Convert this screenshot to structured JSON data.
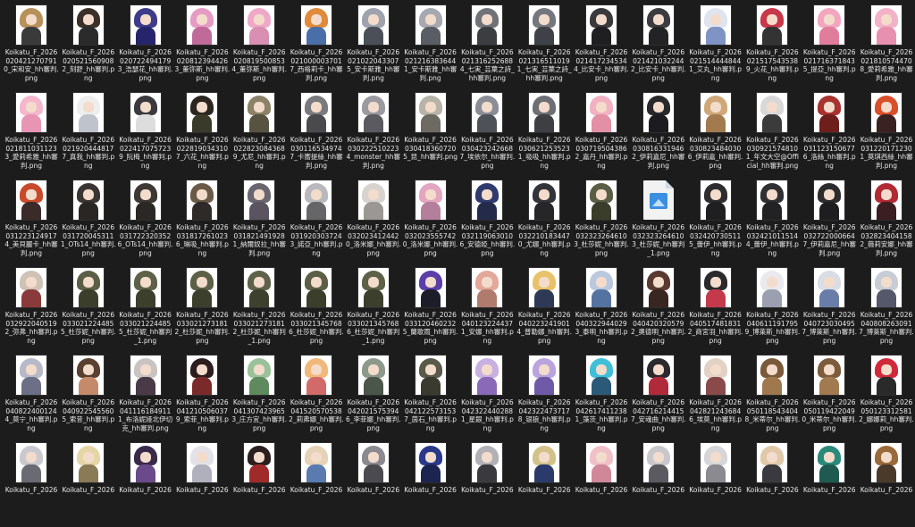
{
  "colors": {
    "background": "#1c1c1c",
    "text": "#e8e8e8",
    "image_icon": "#3b8fe0"
  },
  "files": [
    {
      "name": "Koikatu_F_2026020421270791 0_宋和安_hh審判.png",
      "hair": "#b8905a",
      "body": "#3a3a3a"
    },
    {
      "name": "Koikatu_F_2026020521560908 2_刻舒_hh審判.png",
      "hair": "#3b3028",
      "body": "#2b2b2b"
    },
    {
      "name": "Koikatu_F_2026020722494179 3_浩瑟花_hh審判.png",
      "hair": "#3e3b8a",
      "body": "#26246a"
    },
    {
      "name": "Koikatu_F_2026020812394426 3_董弥斯_hh審判.png",
      "hair": "#e59cc4",
      "body": "#c06a9a"
    },
    {
      "name": "Koikatu_F_2026020819500853 4_董弥斯_hh審判.png",
      "hair": "#f0a8c8",
      "body": "#d88fb1"
    },
    {
      "name": "Koikatu_F_2026021000003701 7_西格莉卡_hh審判.png",
      "hair": "#e08a3c",
      "body": "#4a6ea8"
    },
    {
      "name": "Koikatu_F_2026021022043307 5_安卡斯雅_hh審判.png",
      "hair": "#9ea3ad",
      "body": "#4b4f57"
    },
    {
      "name": "Koikatu_F_2026021216383644 1_安卡斯雅_hh審判.png",
      "hair": "#a6a9b0",
      "body": "#5a5d63"
    },
    {
      "name": "Koikatu_F_2026021316252688 4_七実_芸葉之詩_hh審判.png",
      "hair": "#6f7378",
      "body": "#3b3d40"
    },
    {
      "name": "Koikatu_F_2026021316511019 1_七実_芸葉之詩_hh審判.png",
      "hair": "#74787e",
      "body": "#3f4146"
    },
    {
      "name": "Koikatu_F_2026021417234534 4_比安卡_hh審判.png",
      "hair": "#3a3a3d",
      "body": "#1f1f22"
    },
    {
      "name": "Koikatu_F_2026021421032244 2_比安卡_hh審判.png",
      "hair": "#3c3c40",
      "body": "#232326"
    },
    {
      "name": "Koikatu_F_2026021514444844 1_艾丸_hh審判.png",
      "hair": "#dfe4ee",
      "body": "#7f93c4"
    },
    {
      "name": "Koikatu_F_2026021517543538 9_火花_hh審判.png",
      "hair": "#c8384a",
      "body": "#333333"
    },
    {
      "name": "Koikatu_F_2026021716371843 5_提亞_hh審判.png",
      "hair": "#f2a6c0",
      "body": "#e07d9d"
    },
    {
      "name": "Koikatu_F_2026021810574470 8_愛莉希雅_hh審判.png",
      "hair": "#f3b2c8",
      "body": "#e790b0"
    },
    {
      "name": "Koikatu_F_2026021811031123 3_愛莉希雅_hh審判.png",
      "hair": "#f4b7cc",
      "body": "#e895b4"
    },
    {
      "name": "Koikatu_F_2026021920444817 7_真我_hh審判.png",
      "hair": "#eeeeee",
      "body": "#bfc4cc"
    },
    {
      "name": "Koikatu_F_2026022417075723 9_阮梅_hh審判.png",
      "hair": "#3a3a3e",
      "body": "#dddddd"
    },
    {
      "name": "Koikatu_F_2026022819034310 7_六花_hh審判.png",
      "hair": "#2b2620",
      "body": "#3a3a2a"
    },
    {
      "name": "Koikatu_F_2026022823084368 9_尤尼_hh審判.png",
      "hair": "#8c8268",
      "body": "#585241"
    },
    {
      "name": "Koikatu_F_2026030116534974 7_卡嚮提絲_hh審判.png",
      "hair": "#7a7a7e",
      "body": "#4a4a4e"
    },
    {
      "name": "Koikatu_F_2026030222510223 4_monster_hh審判.png",
      "hair": "#9a9aa0",
      "body": "#5a5a60"
    },
    {
      "name": "Koikatu_F_2026030418360720 5_昆_hh審判.png",
      "hair": "#b8b3a8",
      "body": "#6d6a64"
    },
    {
      "name": "Koikatu_F_2026030423242668 7_埃依尔_hh審判.png",
      "hair": "#8a8d95",
      "body": "#4e5158"
    },
    {
      "name": "Koikatu_F_2026030621253523 1_吸吸_hh審判.png",
      "hair": "#6d6f74",
      "body": "#3d3f43"
    },
    {
      "name": "Koikatu_F_2026030719504386 2_嘉丹_hh審判.png",
      "hair": "#f2b2c2",
      "body": "#e38fa5"
    },
    {
      "name": "Koikatu_F_2026030816331946 2_伊莉嘉尼_hh審判.png",
      "hair": "#29292c",
      "body": "#1c1c20"
    },
    {
      "name": "Koikatu_F_2026030823484030 6_伊莉嘉_hh審判.png",
      "hair": "#d0a878",
      "body": "#a37a4e"
    },
    {
      "name": "Koikatu_F_2026030921574810 1_年文大空@Official_hh審判.png",
      "hair": "#d8d8d8",
      "body": "#3b3b3b"
    },
    {
      "name": "Koikatu_F_2026031123150677 6_洛絲_hh審判.png",
      "hair": "#a8322e",
      "body": "#6e1f1c"
    },
    {
      "name": "Koikatu_F_2026031220171230 1_莫琪西絲_hh審判.png",
      "hair": "#d9502a",
      "body": "#3a2222"
    },
    {
      "name": "Koikatu_F_2026031223124917 4_美貝麗卡_hh審判.png",
      "hair": "#c94a2b",
      "body": "#3a2a2a"
    },
    {
      "name": "Koikatu_F_2026031720045311 1_OTs14_hh審判.png",
      "hair": "#3a3532",
      "body": "#2a2624"
    },
    {
      "name": "Koikatu_F_2026031722320352 6_OTs14_hh審判.png",
      "hair": "#3d3835",
      "body": "#2b2725"
    },
    {
      "name": "Koikatu_F_2026031817261023 6_琳吸_hh審判.png",
      "hair": "#6b5a48",
      "body": "#2d2a28"
    },
    {
      "name": "Koikatu_F_2026031821491928 1_納爾奴拉_hh審判.png",
      "hair": "#6a6670",
      "body": "#5a5460"
    },
    {
      "name": "Koikatu_F_2026031920303724 3_諾亞_hh審判.png",
      "hair": "#b9b9bd",
      "body": "#66666a"
    },
    {
      "name": "Koikatu_F_2026032023412442 0_洛米娜_hh審判.png",
      "hair": "#d7d4d0",
      "body": "#9b9794"
    },
    {
      "name": "Koikatu_F_2026032023555742 0_洛米娜_hh審判.png",
      "hair": "#e2a6c0",
      "body": "#b47f9a"
    },
    {
      "name": "Koikatu_F_2026032119063010 6_安德婭_hh審判.png",
      "hair": "#2f3b6e",
      "body": "#242a4a"
    },
    {
      "name": "Koikatu_F_2026032210183447 0_尤娜_hh審判.png",
      "hair": "#33333a",
      "body": "#262628"
    },
    {
      "name": "Koikatu_F_2026032323264610 3_杜莎妮_hh審判.png",
      "hair": "#5a5e44",
      "body": "#3a3d2a"
    },
    {
      "name": "Koikatu_F_2026032323264610 3_杜莎妮_hh審判_1.png",
      "generic": true
    },
    {
      "name": "Koikatu_F_2026032420730511 5_蕾伊_hh審判.png",
      "hair": "#2d2d2f",
      "body": "#1f1f21"
    },
    {
      "name": "Koikatu_F_2026032421011514 4_蕾伊_hh審判.png",
      "hair": "#303033",
      "body": "#222224"
    },
    {
      "name": "Koikatu_F_2026032722000664 7_伊莉嘉尼_hh審判.png",
      "hair": "#2c2c2e",
      "body": "#1e1e20"
    },
    {
      "name": "Koikatu_F_2026032823404158 2_薇莉安娜_hh審判.png",
      "hair": "#b22a34",
      "body": "#3a1e22"
    },
    {
      "name": "Koikatu_F_2026032922040519 2_弥弗_hh審判.png",
      "hair": "#cfc2b6",
      "body": "#8a3a3a"
    },
    {
      "name": "Koikatu_F_2026033021224485 5_杜莎妮_hh審判.png",
      "hair": "#5b5f45",
      "body": "#3b3e2b"
    },
    {
      "name": "Koikatu_F_2026033021224485 5_杜莎妮_hh審判_1.png",
      "hair": "#5d6147",
      "body": "#3c3f2c"
    },
    {
      "name": "Koikatu_F_2026033021273181 2_杜莎妮_hh審判.png",
      "hair": "#5c6046",
      "body": "#3c3f2c"
    },
    {
      "name": "Koikatu_F_2026033021273181 2_杜莎妮_hh審判_1.png",
      "hair": "#5e6248",
      "body": "#3d402d"
    },
    {
      "name": "Koikatu_F_2026033021345768 6_杜莎妮_hh審判.png",
      "hair": "#5b5f45",
      "body": "#3b3e2b"
    },
    {
      "name": "Koikatu_F_2026033021345768 6_杜莎妮_hh審判_1.png",
      "hair": "#5d6147",
      "body": "#3c3f2c"
    },
    {
      "name": "Koikatu_F_2026033120460232 5_蘭歌雨_hh審判.png",
      "hair": "#5b3fa8",
      "body": "#1d1d2a"
    },
    {
      "name": "Koikatu_F_2026040123224437 1_安娜_hh審判.png",
      "hair": "#e3a89a",
      "body": "#b07a6d"
    },
    {
      "name": "Koikatu_F_2026040223241901 4_普勒娜_hh審判.png",
      "hair": "#e8c26a",
      "body": "#2e3a55"
    },
    {
      "name": "Koikatu_F_2026040322944029 3_泰明_hh審判.png",
      "hair": "#b9c8de",
      "body": "#5573a0"
    },
    {
      "name": "Koikatu_F_2026040420320579 2_奧德明_hh審判.png",
      "hair": "#5a3a30",
      "body": "#3a2620"
    },
    {
      "name": "Koikatu_F_2026040517481831 2_商宮羽_hh審判.png",
      "hair": "#2a2a2c",
      "body": "#c43a4a"
    },
    {
      "name": "Koikatu_F_2026040611191795 9_博萊斯_hh審判.png",
      "hair": "#e9e9ee",
      "body": "#9aa0b0"
    },
    {
      "name": "Koikatu_F_2026040723030495 7_博萊斯_hh審判.png",
      "hair": "#d9dde6",
      "body": "#6a7da8"
    },
    {
      "name": "Koikatu_F_2026040808263091 7_博萊斯_hh審判.png",
      "hair": "#c8ccd4",
      "body": "#54586a"
    },
    {
      "name": "Koikatu_F_2026040822400124 4_莫宁_hh審判.png",
      "hair": "#b7b9c8",
      "body": "#6c6f86"
    },
    {
      "name": "Koikatu_F_2026040922545560 5_索昔_hh審判.png",
      "hair": "#5a4030",
      "body": "#c48a6a"
    },
    {
      "name": "Koikatu_F_2026041116184911 1_布洛妮娅北伊切克_hh審判.png",
      "hair": "#c9c4c2",
      "body": "#4a3a48"
    },
    {
      "name": "Koikatu_F_2026041210506037 9_索菲_hh審判.png",
      "hair": "#2c1e1e",
      "body": "#7a2a2a"
    },
    {
      "name": "Koikatu_F_2026041307423965 3_庄方宜_hh審判.png",
      "hair": "#9ac29a",
      "body": "#5e8a5e"
    },
    {
      "name": "Koikatu_F_2026041520570538 2_莉弗娜_hh審判.png",
      "hair": "#f0b87a",
      "body": "#d36a6a"
    },
    {
      "name": "Koikatu_F_2026042021575394 6_李菲娜_hh審判.png",
      "hair": "#8b9a8a",
      "body": "#4a564a"
    },
    {
      "name": "Koikatu_F_2026042122573153 7_茵石_hh審判.png",
      "hair": "#5a5a4a",
      "body": "#3a3a2e"
    },
    {
      "name": "Koikatu_F_2026042322440288 1_星銀_hh審判.png",
      "hair": "#c8b0e0",
      "body": "#8a6ab8"
    },
    {
      "name": "Koikatu_F_2026042322473717 8_银狼_hh審判.png",
      "hair": "#b9a4de",
      "body": "#6f5aa8"
    },
    {
      "name": "Koikatu_F_2026042617411238 1_藻茨_hh審判.png",
      "hair": "#3fc0d8",
      "body": "#2a5a78"
    },
    {
      "name": "Koikatu_F_2026042716214415 7_安魂曲_hh審判.png",
      "hair": "#2a2a2e",
      "body": "#b02a3a"
    },
    {
      "name": "Koikatu_F_2026042821243684 6_埃莫_hh審判.png",
      "hair": "#e2d2c6",
      "body": "#8a4a4a"
    },
    {
      "name": "Koikatu_F_2026050118543404 8_米蒂尔_hh審判.png",
      "hair": "#7a5a3a",
      "body": "#a0784e"
    },
    {
      "name": "Koikatu_F_2026050119422049 0_米蒂尔_hh審判.png",
      "hair": "#7c5c3c",
      "body": "#a27a50"
    },
    {
      "name": "Koikatu_F_2026050123312581 2_娜娜莉_hh審判.png",
      "hair": "#d02a3a",
      "body": "#2a2a2a"
    },
    {
      "name": "Koikatu_F_2026",
      "hair": "#c9c9cf",
      "body": "#6a6a72"
    },
    {
      "name": "Koikatu_F_2026",
      "hair": "#e6d6a6",
      "body": "#8a7a56"
    },
    {
      "name": "Koikatu_F_2026",
      "hair": "#3a2a4a",
      "body": "#6a4a8a"
    },
    {
      "name": "Koikatu_F_2026",
      "hair": "#e2e2e8",
      "body": "#b0b0bc"
    },
    {
      "name": "Koikatu_F_2026",
      "hair": "#2a1e1e",
      "body": "#a02a2a"
    },
    {
      "name": "Koikatu_F_2026",
      "hair": "#e6d2b6",
      "body": "#5a7ab0"
    },
    {
      "name": "Koikatu_F_2026",
      "hair": "#8a8a90",
      "body": "#4a4a50"
    },
    {
      "name": "Koikatu_F_2026",
      "hair": "#2a3a8a",
      "body": "#1c2450"
    },
    {
      "name": "Koikatu_F_2026",
      "hair": "#b0b0b6",
      "body": "#3a3a3e"
    },
    {
      "name": "Koikatu_F_2026",
      "hair": "#d2c28a",
      "body": "#2a3a6a"
    },
    {
      "name": "Koikatu_F_2026",
      "hair": "#f0c0c8",
      "body": "#d08898"
    },
    {
      "name": "Koikatu_F_2026",
      "hair": "#c8c8cc",
      "body": "#5a5a60"
    },
    {
      "name": "Koikatu_F_2026",
      "hair": "#d6d6da",
      "body": "#8a8a90"
    },
    {
      "name": "Koikatu_F_2026",
      "hair": "#e0c8a8",
      "body": "#3a3a3e"
    },
    {
      "name": "Koikatu_F_2026",
      "hair": "#2a8a7a",
      "body": "#1e5a50"
    },
    {
      "name": "Koikatu_F_2026",
      "hair": "#9a6a3a",
      "body": "#4a3a2a"
    }
  ]
}
